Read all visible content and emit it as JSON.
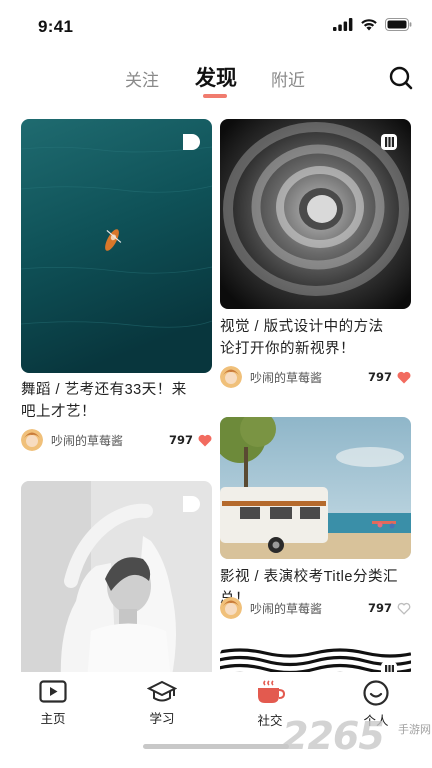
{
  "status_bar": {
    "time": "9:41"
  },
  "header": {
    "tabs": [
      {
        "label": "关注",
        "active": false
      },
      {
        "label": "发现",
        "active": true
      },
      {
        "label": "附近",
        "active": false
      }
    ],
    "accent_color": "#f07b6e"
  },
  "feed": [
    {
      "title": "舞蹈 / 艺考还有33天！来吧上才艺！",
      "author": "吵闹的草莓酱",
      "likes": "797",
      "liked": true,
      "media": "video",
      "scene": "aerial ocean with kayak"
    },
    {
      "title": "视觉 / 版式设计中的方法论打开你的新视界！",
      "author": "吵闹的草莓酱",
      "likes": "797",
      "liked": true,
      "media": "gallery",
      "scene": "spiral staircase"
    },
    {
      "title": "",
      "author": "",
      "likes": "",
      "media": "video",
      "scene": "black and white portrait"
    },
    {
      "title": "影视 / 表演校考Title分类汇总！",
      "author": "吵闹的草莓酱",
      "likes": "797",
      "liked": false,
      "media": "photo",
      "scene": "camper van on beach"
    },
    {
      "title": "",
      "author": "",
      "likes": "",
      "media": "gallery",
      "scene": "black and white wave pattern"
    }
  ],
  "bottom_nav": [
    {
      "label": "主页",
      "icon": "play-icon"
    },
    {
      "label": "学习",
      "icon": "graduation-cap-icon"
    },
    {
      "label": "社交",
      "icon": "coffee-cup-icon"
    },
    {
      "label": "个人",
      "icon": "smiley-icon"
    }
  ],
  "watermark": {
    "number": "2265",
    "text": "手游网"
  },
  "colors": {
    "like_active": "#f26b5f",
    "like_inactive": "#bdbdbd",
    "home_icon": "#2b2b2b"
  }
}
